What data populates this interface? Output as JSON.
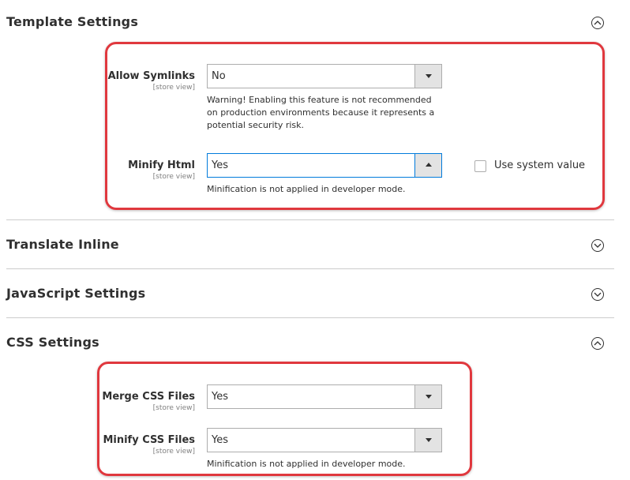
{
  "sections": {
    "template": {
      "title": "Template Settings",
      "state": "expanded"
    },
    "translate": {
      "title": "Translate Inline",
      "state": "collapsed"
    },
    "javascript": {
      "title": "JavaScript Settings",
      "state": "collapsed"
    },
    "css": {
      "title": "CSS Settings",
      "state": "expanded"
    }
  },
  "template_fields": {
    "allow_symlinks": {
      "label": "Allow Symlinks",
      "scope": "[store view]",
      "value": "No",
      "note_lines": [
        "Warning! Enabling this feature is not recommended",
        "on production environments because it represents a",
        "potential security risk."
      ]
    },
    "minify_html": {
      "label": "Minify Html",
      "scope": "[store view]",
      "value": "Yes",
      "note": "Minification is not applied in developer mode.",
      "use_system_value_label": "Use system value",
      "use_system_value_checked": false
    }
  },
  "css_fields": {
    "merge_css": {
      "label": "Merge CSS Files",
      "scope": "[store view]",
      "value": "Yes"
    },
    "minify_css": {
      "label": "Minify CSS Files",
      "scope": "[store view]",
      "value": "Yes",
      "note": "Minification is not applied in developer mode."
    }
  },
  "colors": {
    "highlight": "#e0383e",
    "focus": "#007bdb",
    "text": "#303030",
    "muted": "#808080"
  },
  "icons": {
    "expanded": "chevron-up-circle-icon",
    "collapsed": "chevron-down-circle-icon",
    "select_closed": "caret-down-icon",
    "select_open": "caret-up-icon"
  }
}
